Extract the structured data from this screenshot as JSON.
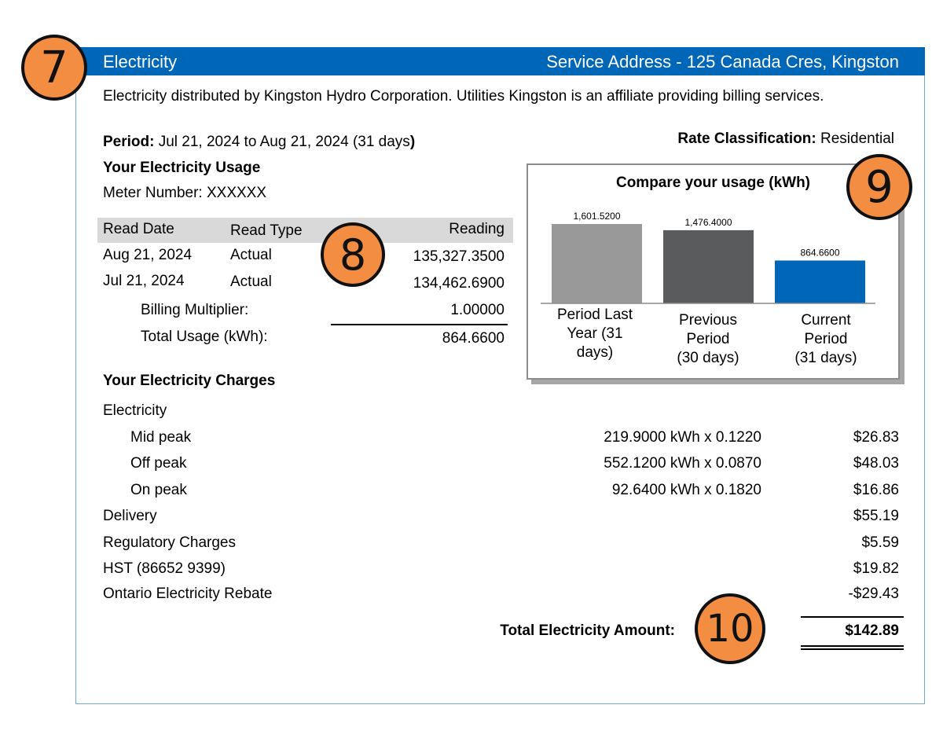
{
  "header": {
    "title": "Electricity",
    "service_address": "Service Address - 125 Canada Cres, Kingston"
  },
  "description": "Electricity distributed by Kingston Hydro Corporation. Utilities Kingston is an affiliate providing billing services.",
  "period": {
    "label": "Period:",
    "value": "Jul 21, 2024 to Aug 21, 2024 (31 days",
    "close": ")"
  },
  "rate_classification": {
    "label": "Rate Classification:",
    "value": "Residential"
  },
  "usage": {
    "title": "Your Electricity Usage",
    "meter": "Meter Number: XXXXXX",
    "columns": [
      "Read Date",
      "Read Type",
      "Reading"
    ],
    "rows": [
      {
        "date": "Aug 21, 2024",
        "type": "Actual",
        "reading": "135,327.3500"
      },
      {
        "date": "Jul 21, 2024",
        "type": "Actual",
        "reading": "134,462.6900"
      }
    ],
    "multiplier_label": "Billing Multiplier:",
    "multiplier_value": "1.00000",
    "total_label": "Total Usage (kWh):",
    "total_value": "864.6600"
  },
  "badges": [
    "7",
    "8",
    "9",
    "10"
  ],
  "chart_data": {
    "type": "bar",
    "title": "Compare your usage (kWh)",
    "categories": [
      "Period Last Year (31 days)",
      "Previous Period (30 days)",
      "Current Period (31 days)"
    ],
    "category_lines": [
      [
        "Period Last",
        "Year (31",
        "days)"
      ],
      [
        "Previous",
        "Period",
        "(30 days)"
      ],
      [
        "Current",
        "Period",
        "(31 days)"
      ]
    ],
    "values": [
      1601.52,
      1476.4,
      864.66
    ],
    "value_labels": [
      "1,601.5200",
      "1,476.4000",
      "864.6600"
    ],
    "colors": [
      "#999999",
      "#595b5d",
      "#0067b8"
    ],
    "ylim": [
      0,
      1601.52
    ]
  },
  "charges": {
    "title": "Your Electricity Charges",
    "electricity_label": "Electricity",
    "items": [
      {
        "label": "Mid peak",
        "detail": "219.9000 kWh x 0.1220",
        "amount": "$26.83"
      },
      {
        "label": "Off peak",
        "detail": "552.1200 kWh x 0.0870",
        "amount": "$48.03"
      },
      {
        "label": "On peak",
        "detail": "92.6400 kWh x 0.1820",
        "amount": "$16.86"
      }
    ],
    "other": [
      {
        "label": "Delivery",
        "amount": "$55.19"
      },
      {
        "label": "Regulatory Charges",
        "amount": "$5.59"
      },
      {
        "label": "HST (86652 9399)",
        "amount": "$19.82"
      },
      {
        "label": "Ontario Electricity Rebate",
        "amount": "-$29.43"
      }
    ],
    "total_label": "Total Electricity Amount:",
    "total_value": "$142.89"
  }
}
